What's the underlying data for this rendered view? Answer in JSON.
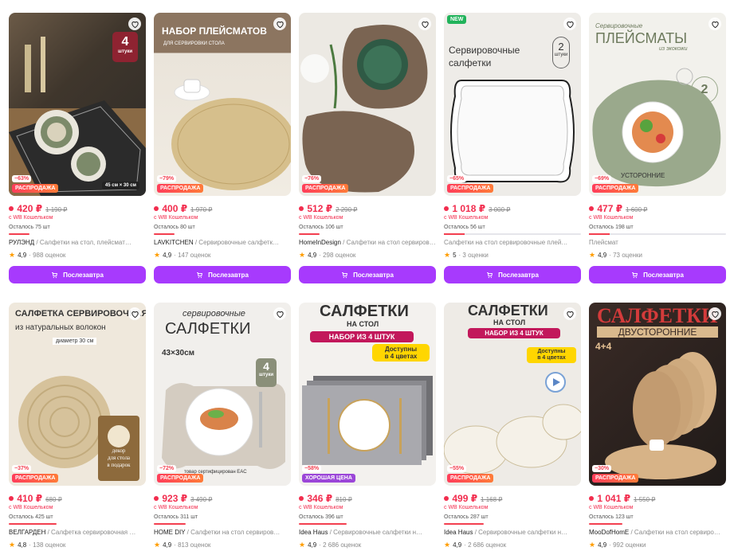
{
  "colors": {
    "accent": "#a73afd",
    "price": "#f22d4e"
  },
  "products": [
    {
      "price": "420 ₽",
      "old": "1 190 ₽",
      "discount": "−63%",
      "badge": "РАСПРОДАЖА",
      "wallet": "с WB Кошельком",
      "left": "Осталось 75 шт",
      "brand": "РУЛЭНД",
      "name": " / Салфетки на стол, плейсмат…",
      "rating": "4,9",
      "reviews": "· 988 оценок",
      "button": "Послезавтра",
      "img_texts": [
        "4",
        "штуки",
        "45 см × 30 см"
      ]
    },
    {
      "price": "400 ₽",
      "old": "1 970 ₽",
      "discount": "−79%",
      "badge": "РАСПРОДАЖА",
      "wallet": "с WB Кошельком",
      "left": "Осталось 80 шт",
      "brand": "LAVKITCHEN",
      "name": " / Сервировочные салфетк…",
      "rating": "4,9",
      "reviews": "· 147 оценок",
      "button": "Послезавтра",
      "img_texts": [
        "НАБОР ПЛЕЙСМАТОВ",
        "ДЛЯ СЕРВИРОВКИ СТОЛА"
      ]
    },
    {
      "price": "512 ₽",
      "old": "2 290 ₽",
      "discount": "−76%",
      "badge": "РАСПРОДАЖА",
      "wallet": "с WB Кошельком",
      "left": "Осталось 106 шт",
      "brand": "HomeInDesign",
      "name": " / Салфетки на стол сервиров…",
      "rating": "4,9",
      "reviews": "· 298 оценок",
      "button": "Послезавтра",
      "img_texts": []
    },
    {
      "price": "1 018 ₽",
      "old": "3 000 ₽",
      "discount": "−65%",
      "badge": "РАСПРОДАЖА",
      "wallet": "с WB Кошельком",
      "left": "Осталось 56 шт",
      "brand": "",
      "name": "Салфетки на стол сервировочные плей…",
      "rating": "5",
      "reviews": "· 3 оценки",
      "button": "Послезавтра",
      "new": "NEW",
      "img_texts": [
        "Сервировочные",
        "салфетки",
        "2",
        "штуки"
      ]
    },
    {
      "price": "477 ₽",
      "old": "1 600 ₽",
      "discount": "−69%",
      "badge": "РАСПРОДАЖА",
      "wallet": "с WB Кошельком",
      "left": "Осталось 198 шт",
      "brand": "",
      "name": "Плейсмат",
      "rating": "4,9",
      "reviews": "· 73 оценки",
      "button": "Послезавтра",
      "img_texts": [
        "Сервировочные",
        "ПЛЕЙСМАТЫ",
        "из экокожи",
        "2",
        "УСТОРОННИЕ"
      ]
    },
    {
      "price": "410 ₽",
      "old": "680 ₽",
      "discount": "−37%",
      "badge": "РАСПРОДАЖА",
      "wallet": "с WB Кошельком",
      "left": "Осталось 425 шт",
      "brand": "ВЕЛГАРДЕН",
      "name": " / Салфетка сервировочная …",
      "rating": "4,8",
      "reviews": "· 138 оценок",
      "img_texts": [
        "САЛФЕТКА СЕРВИРОВОЧНАЯ",
        "из натуральных волокон",
        "диаметр 30 см",
        "декор",
        "для стола",
        "в подарок"
      ]
    },
    {
      "price": "923 ₽",
      "old": "3 490 ₽",
      "discount": "−72%",
      "badge": "РАСПРОДАЖА",
      "wallet": "с WB Кошельком",
      "left": "Осталось 311 шт",
      "brand": "HOME DIY",
      "name": " / Салфетки на стол сервиров…",
      "rating": "4,9",
      "reviews": "· 813 оценок",
      "img_texts": [
        "сервировочные",
        "САЛФЕТКИ",
        "43×30см",
        "4",
        "штуки",
        "товар сертифицирован EAC"
      ]
    },
    {
      "price": "346 ₽",
      "old": "810 ₽",
      "discount": "−58%",
      "badge": "ХОРОШАЯ ЦЕНА",
      "wallet": "с WB Кошельком",
      "left": "Осталось 396 шт",
      "brand": "Idea Haus",
      "name": " / Сервировочные салфетки н…",
      "rating": "4,9",
      "reviews": "· 2 686 оценок",
      "img_texts": [
        "САЛФЕТКИ",
        "НА СТОЛ",
        "НАБОР ИЗ 4 ШТУК",
        "Доступны",
        "в 4 цветах"
      ]
    },
    {
      "price": "499 ₽",
      "old": "1 168 ₽",
      "discount": "−55%",
      "badge": "РАСПРОДАЖА",
      "wallet": "с WB Кошельком",
      "left": "Осталось 287 шт",
      "brand": "Idea Haus",
      "name": " / Сервировочные салфетки н…",
      "rating": "4,9",
      "reviews": "· 2 686 оценок",
      "img_texts": [
        "САЛФЕТКИ",
        "НА СТОЛ",
        "НАБОР ИЗ 4 ШТУК",
        "Доступны",
        "в 4 цветах"
      ]
    },
    {
      "price": "1 041 ₽",
      "old": "1 550 ₽",
      "discount": "−30%",
      "badge": "РАСПРОДАЖА",
      "wallet": "с WB Кошельком",
      "left": "Осталось 123 шт",
      "brand": "MooDofHomE",
      "name": " / Салфетки на стол сервиро…",
      "rating": "4,9",
      "reviews": "· 992 оценки",
      "img_texts": [
        "САЛФЕТКИ",
        "ДВУСТОРОННИЕ",
        "4+4"
      ]
    }
  ]
}
